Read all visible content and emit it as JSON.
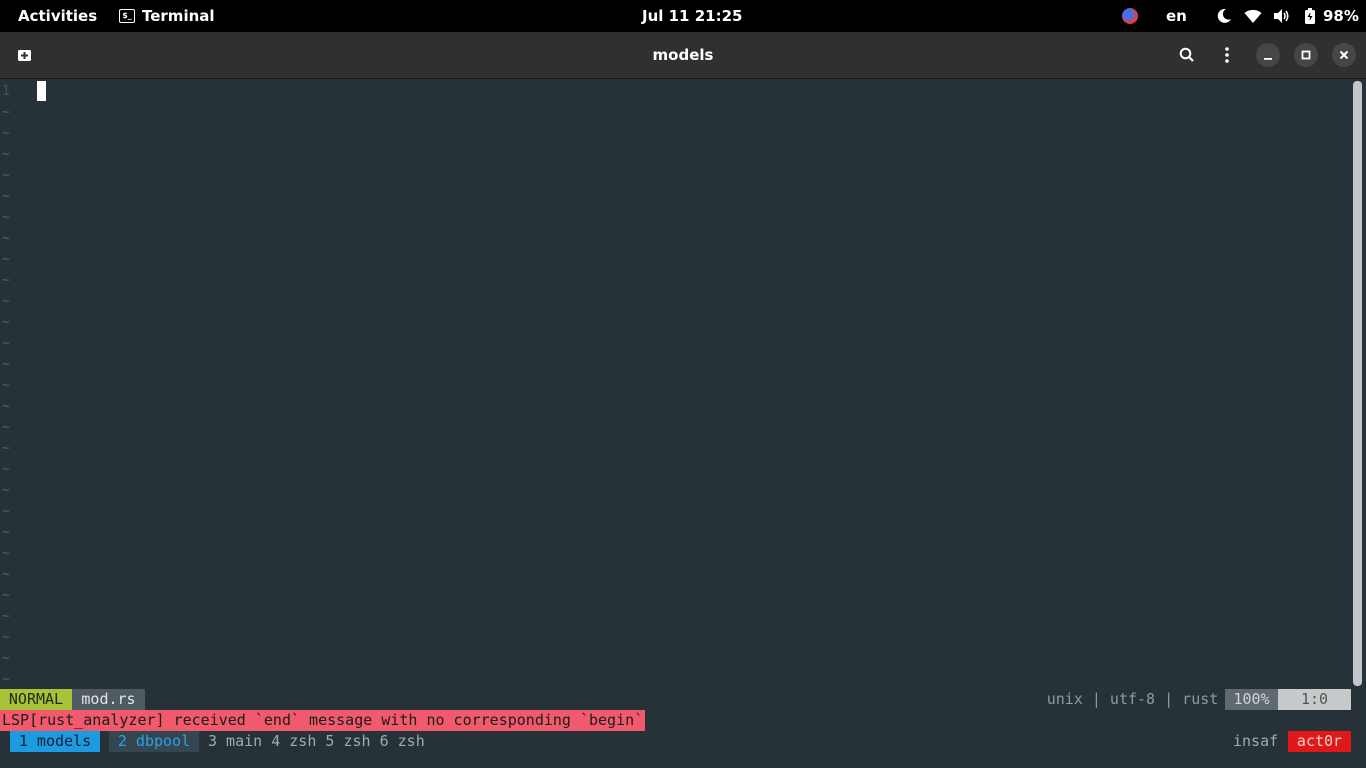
{
  "topbar": {
    "activities": "Activities",
    "app_name": "Terminal",
    "clock": "Jul 11  21:25",
    "language": "en",
    "battery": "98%"
  },
  "window": {
    "title": "models"
  },
  "editor": {
    "line_number": "1",
    "tilde_rows": 28,
    "mode": "NORMAL",
    "filename": "mod.rs",
    "fileinfo": "unix | utf-8 | rust",
    "percent": "100%",
    "position": "1:0",
    "message": "LSP[rust_analyzer] received `end` message with no corresponding `begin`"
  },
  "tmux": {
    "active_window": "1 models",
    "window2": "2 dbpool",
    "other_windows": "3 main 4 zsh 5 zsh 6 zsh",
    "user": "insaf",
    "host": "act0r"
  },
  "colors": {
    "terminal_bg": "#263238",
    "mode_bg": "#a8c33a",
    "error_bg": "#f05a6c",
    "tmux_active": "#1d9be0",
    "tmux_host": "#e01818"
  }
}
